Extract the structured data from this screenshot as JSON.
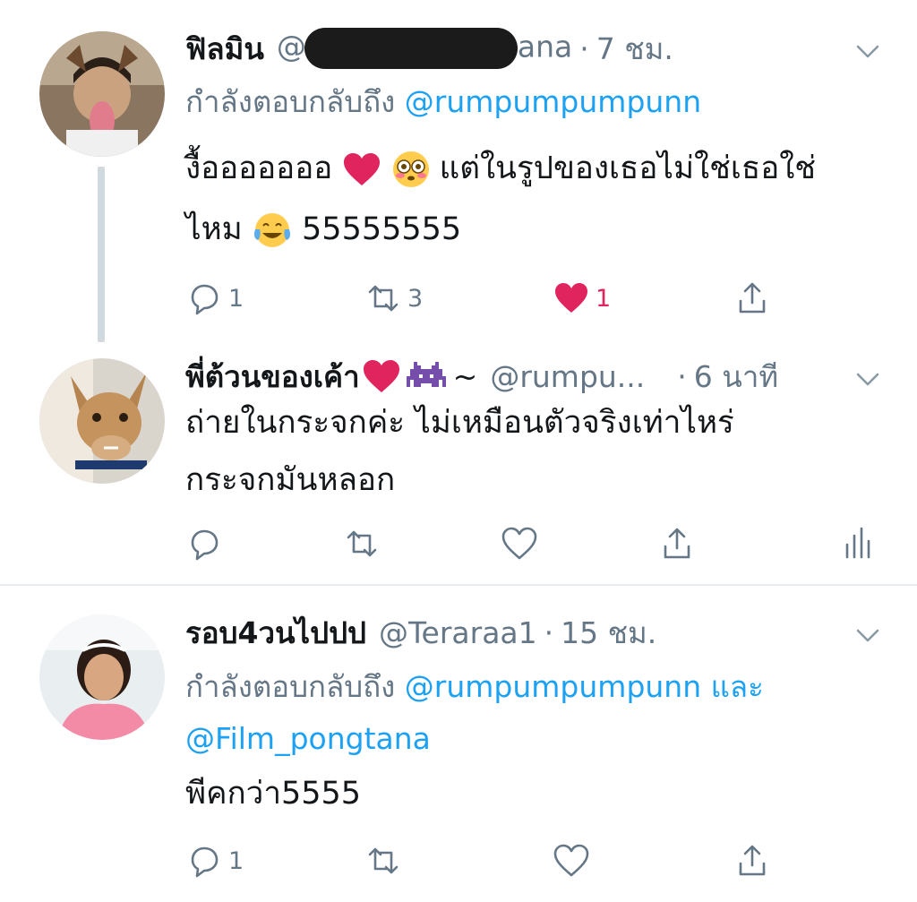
{
  "tweets": [
    {
      "name": "ฟิลมิน",
      "handle_prefix": "@",
      "handle_suffix": "ana",
      "time": "7 ชม.",
      "replying_label": "กำลังตอบกลับถึง",
      "replying_to": "@rumpumpumpunn",
      "text_part1": "งื้อออออออ",
      "text_part2": "แต่ในรูปของเธอไม่ใช่เธอใช่",
      "text_line2_a": "ไหม",
      "text_line2_b": "55555555",
      "reply_count": "1",
      "retweet_count": "3",
      "like_count": "1"
    },
    {
      "name": "พี่ต้วนของเค้า",
      "handle": "@rumpu...",
      "time": "6 นาที",
      "text_line1": "ถ่ายในกระจกค่ะ ไม่เหมือนตัวจริงเท่าไหร่",
      "text_line2": "กระจกมันหลอก"
    },
    {
      "name": "รอบ4วนไปปป",
      "handle": "@Teraraa1",
      "time": "15 ชม.",
      "replying_label": "กำลังตอบกลับถึง",
      "replying_to_1": "@rumpumpumpunn",
      "replying_and": "และ",
      "replying_to_2": "@Film_pongtana",
      "text": "พีคกว่า5555",
      "reply_count": "1"
    }
  ],
  "icons": {
    "reply": "reply-icon",
    "retweet": "retweet-icon",
    "like": "heart-icon",
    "share": "share-icon",
    "analytics": "analytics-icon",
    "more": "chevron-down-icon"
  },
  "colors": {
    "link": "#1da1f2",
    "secondary": "#657786",
    "like_active": "#e0245e",
    "thread_line": "#cfd9de",
    "divider": "#e6ecf0"
  }
}
